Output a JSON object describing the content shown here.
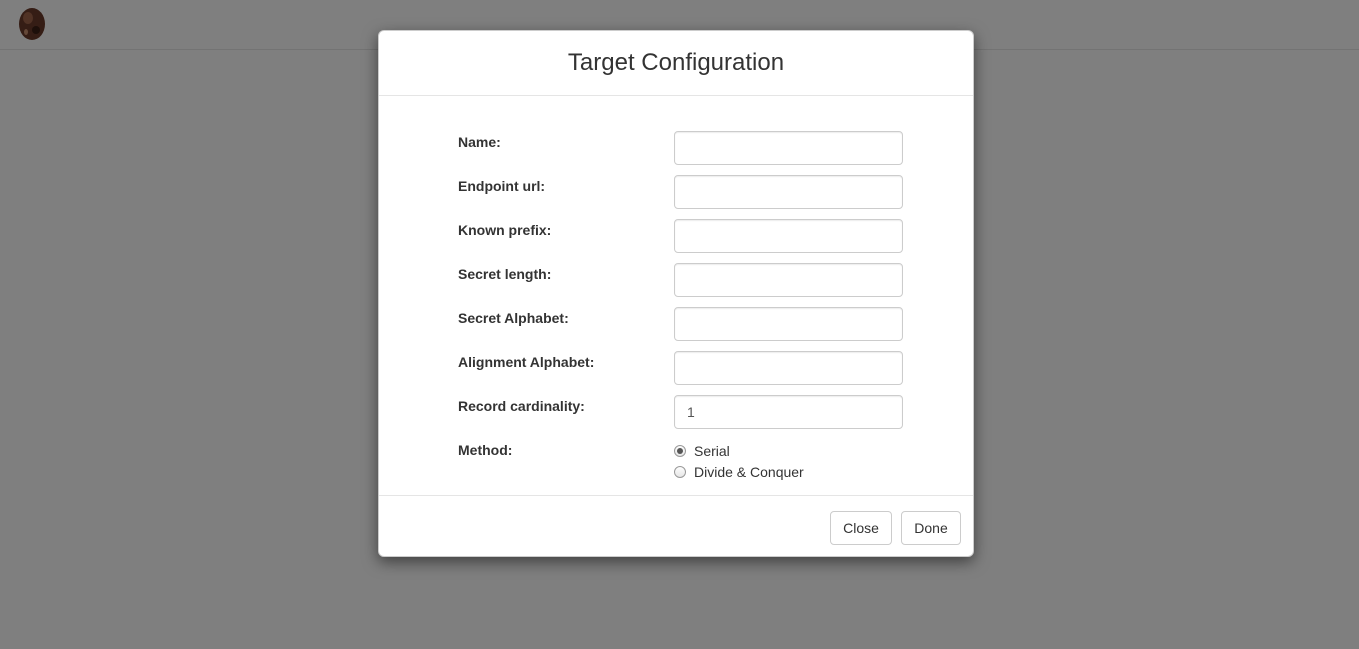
{
  "navbar": {
    "logo_icon": "egg-logo-icon"
  },
  "modal": {
    "title": "Target Configuration",
    "fields": [
      {
        "label": "Name:",
        "value": "",
        "placeholder": ""
      },
      {
        "label": "Endpoint url:",
        "value": "",
        "placeholder": ""
      },
      {
        "label": "Known prefix:",
        "value": "",
        "placeholder": ""
      },
      {
        "label": "Secret length:",
        "value": "",
        "placeholder": ""
      },
      {
        "label": "Secret Alphabet:",
        "value": "",
        "placeholder": ""
      },
      {
        "label": "Alignment Alphabet:",
        "value": "",
        "placeholder": ""
      },
      {
        "label": "Record cardinality:",
        "value": "1",
        "placeholder": ""
      }
    ],
    "method": {
      "label": "Method:",
      "options": [
        "Serial",
        "Divide & Conquer"
      ],
      "selected": "Serial"
    },
    "footer": {
      "close_label": "Close",
      "done_label": "Done"
    }
  },
  "colors": {
    "backdrop": "#808080",
    "modal_bg": "#ffffff",
    "border": "#cccccc",
    "text": "#333333"
  }
}
